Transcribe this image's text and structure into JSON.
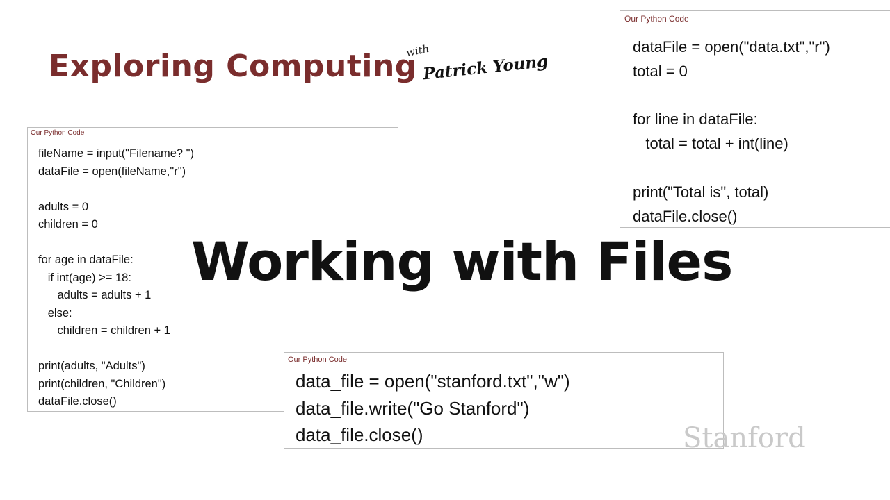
{
  "header": {
    "series_title": "Exploring Computing",
    "with_word": "with",
    "presenter": "Patrick Young"
  },
  "main_title": "Working with Files",
  "code_boxes": {
    "left": {
      "label": "Our Python Code",
      "lines": [
        "fileName = input(\"Filename? \")",
        "dataFile = open(fileName,\"r\")",
        "",
        "adults = 0",
        "children = 0",
        "",
        "for age in dataFile:",
        "   if int(age) >= 18:",
        "      adults = adults + 1",
        "   else:",
        "      children = children + 1",
        "",
        "print(adults, \"Adults\")",
        "print(children, \"Children\")",
        "dataFile.close()"
      ]
    },
    "right": {
      "label": "Our Python Code",
      "lines": [
        "dataFile = open(\"data.txt\",\"r\")",
        "total = 0",
        "",
        "for line in dataFile:",
        "   total = total + int(line)",
        "",
        "print(\"Total is\", total)",
        "dataFile.close()"
      ]
    },
    "bottom": {
      "label": "Our Python Code",
      "lines": [
        "data_file = open(\"stanford.txt\",\"w\")",
        "data_file.write(\"Go Stanford\")",
        "data_file.close()"
      ]
    }
  },
  "logo_text": "Stanford",
  "colors": {
    "title_accent": "#7a2d2d",
    "logo_gray": "#c9c9c9"
  }
}
